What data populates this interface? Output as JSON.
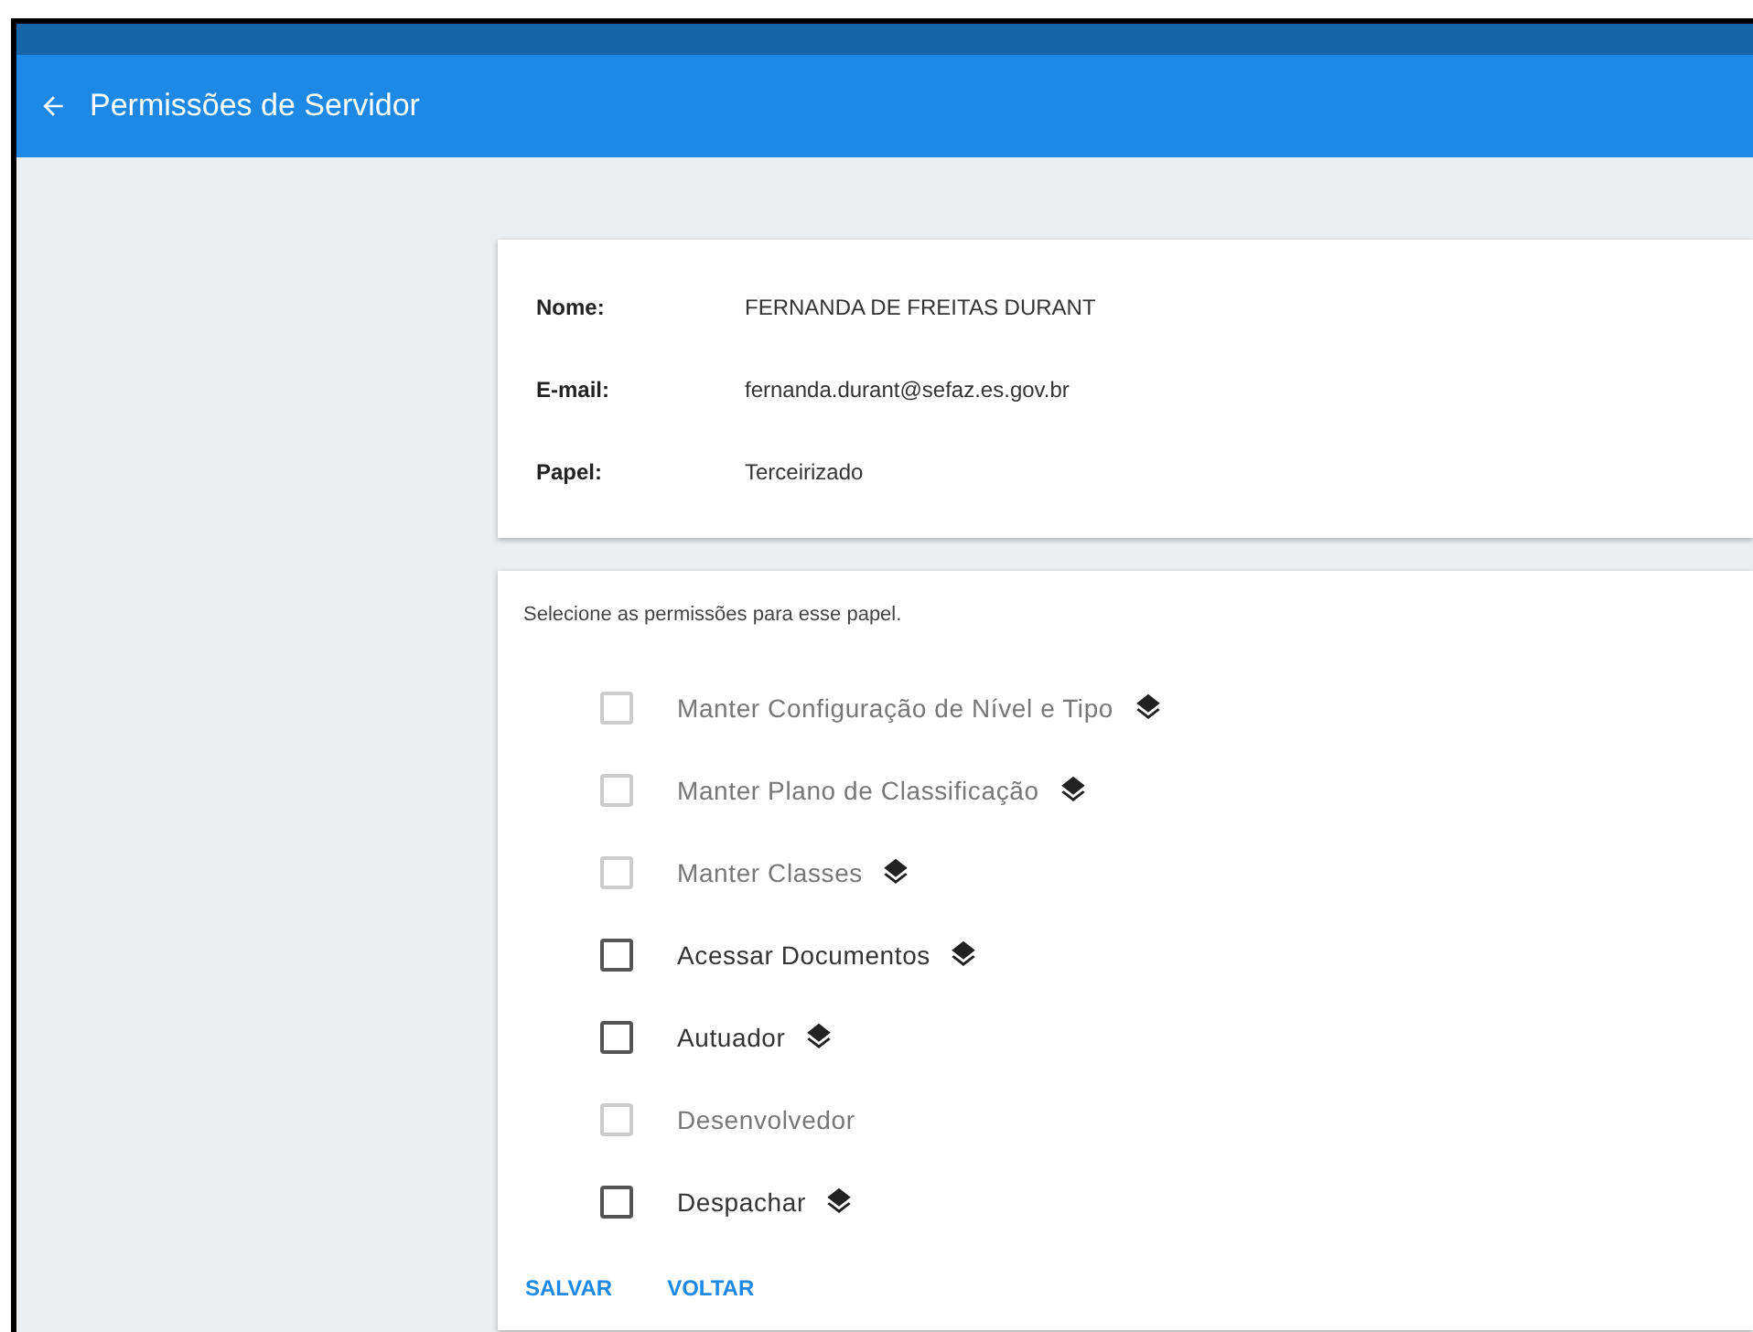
{
  "header": {
    "title": "Permissões de Servidor"
  },
  "profile": [
    {
      "label": "Nome:",
      "value": "FERNANDA DE FREITAS DURANT"
    },
    {
      "label": "E-mail:",
      "value": "fernanda.durant@sefaz.es.gov.br"
    },
    {
      "label": "Papel:",
      "value": "Terceirizado"
    }
  ],
  "permissions": {
    "instruction": "Selecione as permissões para esse papel.",
    "items": [
      {
        "label": "Manter Configuração de Nível e Tipo",
        "checked": false,
        "disabled": true,
        "layers_icon": true
      },
      {
        "label": "Manter Plano de Classificação",
        "checked": false,
        "disabled": true,
        "layers_icon": true
      },
      {
        "label": "Manter Classes",
        "checked": false,
        "disabled": true,
        "layers_icon": true
      },
      {
        "label": "Acessar Documentos",
        "checked": false,
        "disabled": false,
        "layers_icon": true
      },
      {
        "label": "Autuador",
        "checked": false,
        "disabled": false,
        "layers_icon": true
      },
      {
        "label": "Desenvolvedor",
        "checked": false,
        "disabled": true,
        "layers_icon": false
      },
      {
        "label": "Despachar",
        "checked": false,
        "disabled": false,
        "layers_icon": true
      }
    ]
  },
  "actions": [
    "SALVAR",
    "VOLTAR"
  ]
}
